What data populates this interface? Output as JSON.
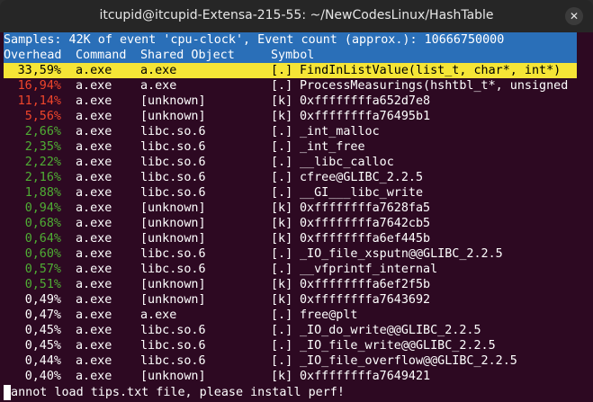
{
  "window": {
    "title": "itcupid@itcupid-Extensa-215-55: ~/NewCodesLinux/HashTable",
    "close_glyph": "✕"
  },
  "summary": "Samples: 42K of event 'cpu-clock', Event count (approx.): 10666750000",
  "columns": {
    "overhead": "Overhead",
    "command": "Command",
    "shared_object": "Shared Object",
    "symbol": "Symbol"
  },
  "colors": {
    "high": "#f0452b",
    "mid": "#4fae34",
    "low": "#ffffff",
    "selected_bg": "#f5e536",
    "header_bg": "#2a6fb8",
    "terminal_bg": "#2d0922"
  },
  "rows": [
    {
      "overhead": "33,59%",
      "command": "a.exe",
      "shared_object": "a.exe",
      "mode": "[.]",
      "symbol": "FindInListValue(list_t, char*, int*)",
      "level": "high",
      "selected": true
    },
    {
      "overhead": "16,94%",
      "command": "a.exe",
      "shared_object": "a.exe",
      "mode": "[.]",
      "symbol": "ProcessMeasurings(hshtbl_t*, unsigned",
      "level": "high"
    },
    {
      "overhead": "11,14%",
      "command": "a.exe",
      "shared_object": "[unknown]",
      "mode": "[k]",
      "symbol": "0xffffffffa652d7e8",
      "level": "high"
    },
    {
      "overhead": "5,56%",
      "command": "a.exe",
      "shared_object": "[unknown]",
      "mode": "[k]",
      "symbol": "0xffffffffa76495b1",
      "level": "high"
    },
    {
      "overhead": "2,66%",
      "command": "a.exe",
      "shared_object": "libc.so.6",
      "mode": "[.]",
      "symbol": "_int_malloc",
      "level": "mid"
    },
    {
      "overhead": "2,35%",
      "command": "a.exe",
      "shared_object": "libc.so.6",
      "mode": "[.]",
      "symbol": "_int_free",
      "level": "mid"
    },
    {
      "overhead": "2,22%",
      "command": "a.exe",
      "shared_object": "libc.so.6",
      "mode": "[.]",
      "symbol": "__libc_calloc",
      "level": "mid"
    },
    {
      "overhead": "2,16%",
      "command": "a.exe",
      "shared_object": "libc.so.6",
      "mode": "[.]",
      "symbol": "cfree@GLIBC_2.2.5",
      "level": "mid"
    },
    {
      "overhead": "1,88%",
      "command": "a.exe",
      "shared_object": "libc.so.6",
      "mode": "[.]",
      "symbol": "__GI___libc_write",
      "level": "mid"
    },
    {
      "overhead": "0,94%",
      "command": "a.exe",
      "shared_object": "[unknown]",
      "mode": "[k]",
      "symbol": "0xffffffffa7628fa5",
      "level": "mid"
    },
    {
      "overhead": "0,68%",
      "command": "a.exe",
      "shared_object": "[unknown]",
      "mode": "[k]",
      "symbol": "0xffffffffa7642cb5",
      "level": "mid"
    },
    {
      "overhead": "0,64%",
      "command": "a.exe",
      "shared_object": "[unknown]",
      "mode": "[k]",
      "symbol": "0xffffffffa6ef445b",
      "level": "mid"
    },
    {
      "overhead": "0,60%",
      "command": "a.exe",
      "shared_object": "libc.so.6",
      "mode": "[.]",
      "symbol": "_IO_file_xsputn@@GLIBC_2.2.5",
      "level": "mid"
    },
    {
      "overhead": "0,57%",
      "command": "a.exe",
      "shared_object": "libc.so.6",
      "mode": "[.]",
      "symbol": "__vfprintf_internal",
      "level": "mid"
    },
    {
      "overhead": "0,51%",
      "command": "a.exe",
      "shared_object": "[unknown]",
      "mode": "[k]",
      "symbol": "0xffffffffa6ef2f5b",
      "level": "mid"
    },
    {
      "overhead": "0,49%",
      "command": "a.exe",
      "shared_object": "[unknown]",
      "mode": "[k]",
      "symbol": "0xffffffffa7643692",
      "level": "low"
    },
    {
      "overhead": "0,47%",
      "command": "a.exe",
      "shared_object": "a.exe",
      "mode": "[.]",
      "symbol": "free@plt",
      "level": "low"
    },
    {
      "overhead": "0,45%",
      "command": "a.exe",
      "shared_object": "libc.so.6",
      "mode": "[.]",
      "symbol": "_IO_do_write@@GLIBC_2.2.5",
      "level": "low"
    },
    {
      "overhead": "0,45%",
      "command": "a.exe",
      "shared_object": "libc.so.6",
      "mode": "[.]",
      "symbol": "_IO_file_write@@GLIBC_2.2.5",
      "level": "low"
    },
    {
      "overhead": "0,44%",
      "command": "a.exe",
      "shared_object": "libc.so.6",
      "mode": "[.]",
      "symbol": "_IO_file_overflow@@GLIBC_2.2.5",
      "level": "low"
    },
    {
      "overhead": "0,40%",
      "command": "a.exe",
      "shared_object": "[unknown]",
      "mode": "[k]",
      "symbol": "0xffffffffa7649421",
      "level": "low"
    }
  ],
  "status": "Cannot load tips.txt file, please install perf!"
}
